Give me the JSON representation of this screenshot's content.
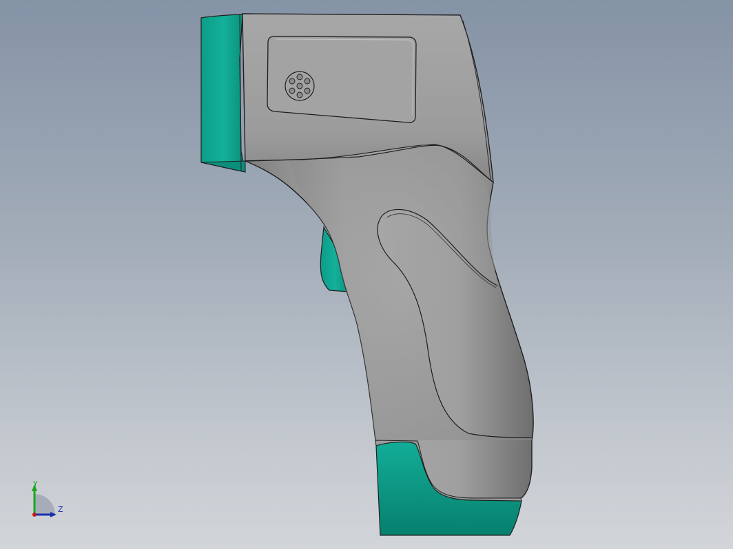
{
  "model": {
    "name": "",
    "colors": {
      "body": "#a6a6a6",
      "body_dark": "#7a7a7a",
      "accent": "#11a892",
      "accent_dark": "#08806f",
      "outline": "#1e1e1e"
    }
  },
  "triad": {
    "x_label": "Z",
    "y_label": "Y",
    "colors": {
      "y": "#18a81c",
      "z": "#1b2fb0",
      "origin": "#c41818"
    }
  }
}
